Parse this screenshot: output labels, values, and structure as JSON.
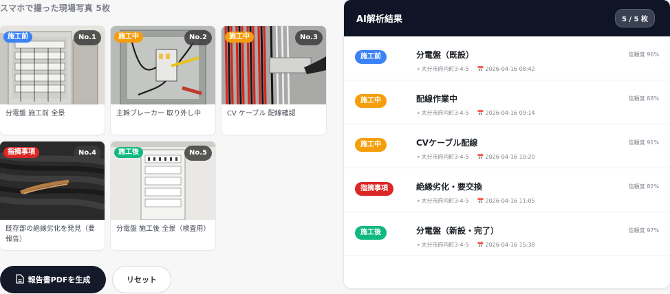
{
  "gallery": {
    "title": "スマホで撮った現場写真 5枚",
    "photos": [
      {
        "tag": "施工前",
        "tag_color": "#3b82f6",
        "num": "No.1",
        "caption": "分電盤 施工前 全景"
      },
      {
        "tag": "施工中",
        "tag_color": "#f59e0b",
        "num": "No.2",
        "caption": "主幹ブレーカー 取り外し中"
      },
      {
        "tag": "施工中",
        "tag_color": "#f59e0b",
        "num": "No.3",
        "caption": "CV ケーブル 配線確認"
      },
      {
        "tag": "指摘事項",
        "tag_color": "#dc2626",
        "num": "No.4",
        "caption": "既存部の絶縁劣化を発見（要報告）"
      },
      {
        "tag": "施工後",
        "tag_color": "#10b981",
        "num": "No.5",
        "caption": "分電盤 施工後 全景（検査用）"
      }
    ]
  },
  "actions": {
    "generate_label": "報告書PDFを生成",
    "reset_label": "リセット"
  },
  "results": {
    "title": "AI解析結果",
    "counter": "5 / 5 枚",
    "items": [
      {
        "tag": "施工前",
        "tag_color": "#3b82f6",
        "title": "分電盤（既設）",
        "location": "大分市府内町3-4-5",
        "datetime": "2026-04-16 08:42",
        "confidence": "信頼度 96%"
      },
      {
        "tag": "施工中",
        "tag_color": "#f59e0b",
        "title": "配線作業中",
        "location": "大分市府内町3-4-5",
        "datetime": "2026-04-16 09:14",
        "confidence": "信頼度 88%"
      },
      {
        "tag": "施工中",
        "tag_color": "#f59e0b",
        "title": "CVケーブル配線",
        "location": "大分市府内町3-4-5",
        "datetime": "2026-04-16 10:20",
        "confidence": "信頼度 91%"
      },
      {
        "tag": "指摘事項",
        "tag_color": "#dc2626",
        "title": "絶縁劣化・要交換",
        "location": "大分市府内町3-4-5",
        "datetime": "2026-04-16 11:05",
        "confidence": "信頼度 82%"
      },
      {
        "tag": "施工後",
        "tag_color": "#10b981",
        "title": "分電盤（新設・完了）",
        "location": "大分市府内町3-4-5",
        "datetime": "2026-04-16 15:38",
        "confidence": "信頼度 97%"
      }
    ]
  }
}
